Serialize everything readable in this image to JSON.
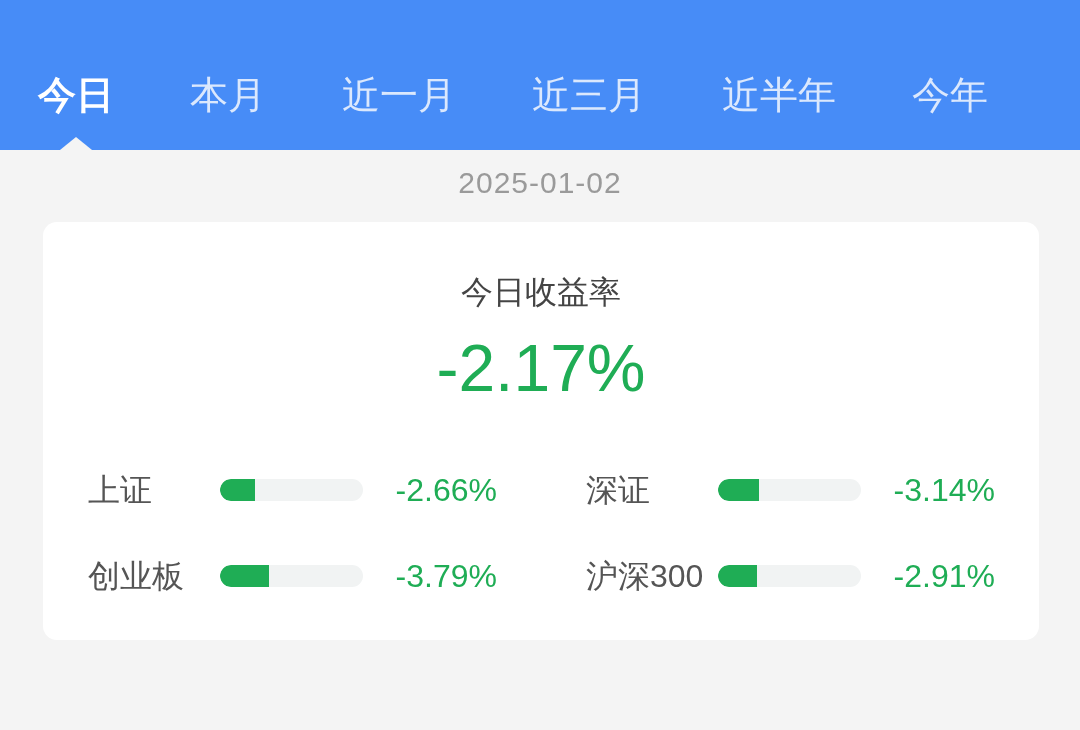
{
  "tabs": [
    {
      "label": "今日",
      "selected": true
    },
    {
      "label": "本月",
      "selected": false
    },
    {
      "label": "近一月",
      "selected": false
    },
    {
      "label": "近三月",
      "selected": false
    },
    {
      "label": "近半年",
      "selected": false
    },
    {
      "label": "今年",
      "selected": false
    }
  ],
  "date": "2025-01-02",
  "summary": {
    "title": "今日收益率",
    "value": "-2.17%"
  },
  "indices": [
    {
      "name": "上证",
      "level": 0.245,
      "change": "-2.66%"
    },
    {
      "name": "深证",
      "level": 0.29,
      "change": "-3.14%"
    },
    {
      "name": "创业板",
      "level": 0.34,
      "change": "-3.79%"
    },
    {
      "name": "沪深300",
      "level": 0.27,
      "change": "-2.91%"
    }
  ]
}
